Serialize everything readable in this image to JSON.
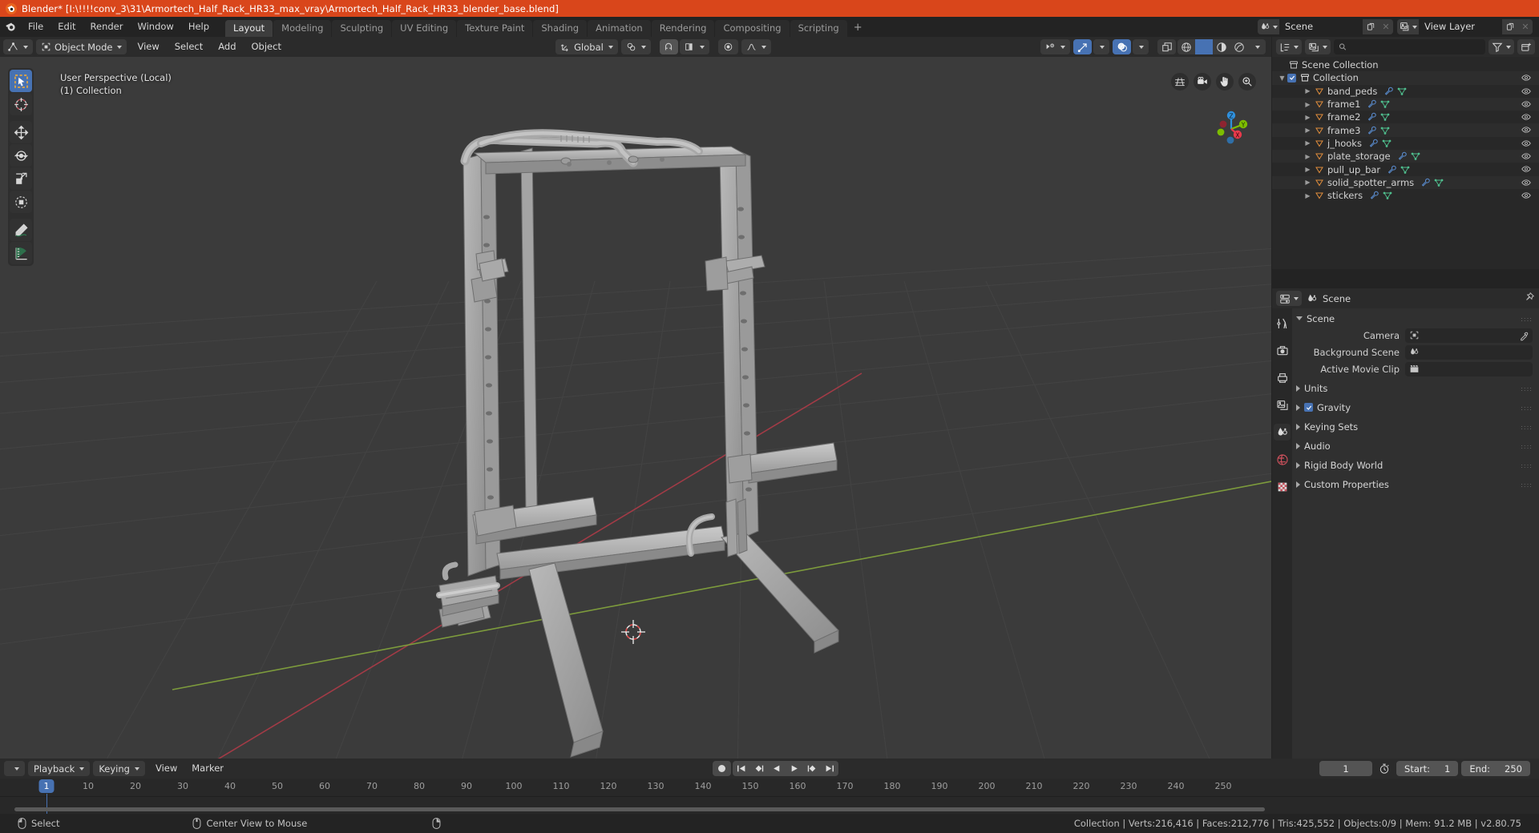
{
  "titlebar": {
    "text": "Blender* [I:\\!!!!conv_3\\31\\Armortech_Half_Rack_HR33_max_vray\\Armortech_Half_Rack_HR33_blender_base.blend]",
    "icon": "blender-logo-icon",
    "bg": "#d9461b"
  },
  "topbar": {
    "menus": [
      "File",
      "Edit",
      "Render",
      "Window",
      "Help"
    ],
    "workspaces": [
      {
        "label": "Layout",
        "active": true
      },
      {
        "label": "Modeling",
        "active": false
      },
      {
        "label": "Sculpting",
        "active": false
      },
      {
        "label": "UV Editing",
        "active": false
      },
      {
        "label": "Texture Paint",
        "active": false
      },
      {
        "label": "Shading",
        "active": false
      },
      {
        "label": "Animation",
        "active": false
      },
      {
        "label": "Rendering",
        "active": false
      },
      {
        "label": "Compositing",
        "active": false
      },
      {
        "label": "Scripting",
        "active": false
      }
    ],
    "add_workspace": "+",
    "scene": {
      "name": "Scene",
      "icon": "scene-icon",
      "new_label": "",
      "remove_label": ""
    },
    "view_layer": {
      "name": "View Layer",
      "icon": "view-layer-icon"
    }
  },
  "viewport_header": {
    "editor_type": "editor-type-3dview-icon",
    "mode": "Object Mode",
    "menus": [
      "View",
      "Select",
      "Add",
      "Object"
    ],
    "transform_orientation": "Global",
    "snap_icon": "magnet-icon",
    "proportional_icon": "proportional-edit-icon",
    "pivot_icon": "pivot-point-icon",
    "falloff_icon": "falloff-curve-icon"
  },
  "viewport": {
    "overlay_line1": "User Perspective (Local)",
    "overlay_line2": "(1) Collection",
    "background": "#3b3b3b",
    "tools": [
      {
        "name": "tweak-select-box",
        "active": true
      },
      {
        "name": "cursor",
        "active": false
      },
      {
        "name": "move",
        "active": false
      },
      {
        "name": "rotate",
        "active": false
      },
      {
        "name": "scale",
        "active": false
      },
      {
        "name": "transform",
        "active": false
      },
      {
        "name": "annotate",
        "active": false
      },
      {
        "name": "measure",
        "active": false
      }
    ],
    "nav_icons": [
      "grid-view-icon",
      "camera-view-icon",
      "pan-view-icon",
      "zoom-view-icon"
    ],
    "gizmo_axes": [
      {
        "label": "Z",
        "color": "#2f90dd"
      },
      {
        "label": "Y",
        "color": "#7dbd00"
      },
      {
        "label": "X",
        "color": "#e8394b"
      }
    ]
  },
  "outliner": {
    "display_mode_icon": "outliner-icon",
    "filter_icon": "filter-icon",
    "new_collection_icon": "new-collection-icon",
    "search_placeholder": "",
    "root": "Scene Collection",
    "collection": {
      "label": "Collection",
      "checked": true,
      "expanded": true
    },
    "objects": [
      {
        "label": "band_peds",
        "modifiers": [
          "wrench-icon",
          "mesh-data-icon"
        ]
      },
      {
        "label": "frame1",
        "modifiers": [
          "wrench-icon",
          "mesh-data-icon"
        ]
      },
      {
        "label": "frame2",
        "modifiers": [
          "wrench-icon",
          "mesh-data-icon"
        ]
      },
      {
        "label": "frame3",
        "modifiers": [
          "wrench-icon",
          "mesh-data-icon"
        ]
      },
      {
        "label": "j_hooks",
        "modifiers": [
          "wrench-icon",
          "mesh-data-icon"
        ]
      },
      {
        "label": "plate_storage",
        "modifiers": [
          "wrench-icon",
          "mesh-data-icon"
        ]
      },
      {
        "label": "pull_up_bar",
        "modifiers": [
          "wrench-icon",
          "mesh-data-icon"
        ]
      },
      {
        "label": "solid_spotter_arms",
        "modifiers": [
          "wrench-icon",
          "mesh-data-icon"
        ]
      },
      {
        "label": "stickers",
        "modifiers": [
          "wrench-icon",
          "mesh-data-icon"
        ]
      }
    ]
  },
  "properties": {
    "breadcrumb": "Scene",
    "breadcrumb_icon": "scene-properties-icon",
    "pin_icon": "pin-icon",
    "tabs": [
      {
        "name": "tool",
        "active": false
      },
      {
        "name": "render",
        "active": false
      },
      {
        "name": "output",
        "active": false
      },
      {
        "name": "view-layer",
        "active": false
      },
      {
        "name": "scene",
        "active": true
      },
      {
        "name": "world",
        "active": false
      },
      {
        "name": "texture",
        "active": false
      }
    ],
    "panel_title": "Scene",
    "fields": [
      {
        "label": "Camera",
        "value": "",
        "icon": "camera-data-icon",
        "eyedropper": true
      },
      {
        "label": "Background Scene",
        "value": "",
        "icon": "scene-icon",
        "eyedropper": false
      },
      {
        "label": "Active Movie Clip",
        "value": "",
        "icon": "movie-clip-icon",
        "eyedropper": false
      }
    ],
    "sections": [
      {
        "label": "Units",
        "checkbox": false
      },
      {
        "label": "Gravity",
        "checkbox": true
      },
      {
        "label": "Keying Sets",
        "checkbox": false
      },
      {
        "label": "Audio",
        "checkbox": false
      },
      {
        "label": "Rigid Body World",
        "checkbox": false
      },
      {
        "label": "Custom Properties",
        "checkbox": false
      }
    ]
  },
  "timeline": {
    "editor_icon": "timeline-icon",
    "menus_dd": [
      "Playback",
      "Keying"
    ],
    "menus_plain": [
      "View",
      "Marker"
    ],
    "transport": [
      "jump-start-icon",
      "prev-keyframe-icon",
      "play-reverse-icon",
      "play-icon",
      "next-keyframe-icon",
      "jump-end-icon"
    ],
    "record_icon": "auto-keying-icon",
    "current_frame": "1",
    "start_label": "Start:",
    "start_value": "1",
    "end_label": "End:",
    "end_value": "250",
    "ticks": [
      "1",
      "10",
      "20",
      "30",
      "40",
      "50",
      "60",
      "70",
      "80",
      "90",
      "100",
      "110",
      "120",
      "130",
      "140",
      "150",
      "160",
      "170",
      "180",
      "190",
      "200",
      "210",
      "220",
      "230",
      "240",
      "250"
    ],
    "playhead_label": "1"
  },
  "statusbar": {
    "left_items": [
      {
        "icon": "mouse-left-icon",
        "label": "Select"
      },
      {
        "icon": "mouse-middle-icon",
        "label": "Center View to Mouse"
      },
      {
        "icon": "mouse-right-icon",
        "label": ""
      }
    ],
    "stats": "Collection | Verts:216,416 | Faces:212,776 | Tris:425,552 | Objects:0/9 | Mem: 91.2 MB | v2.80.75"
  }
}
